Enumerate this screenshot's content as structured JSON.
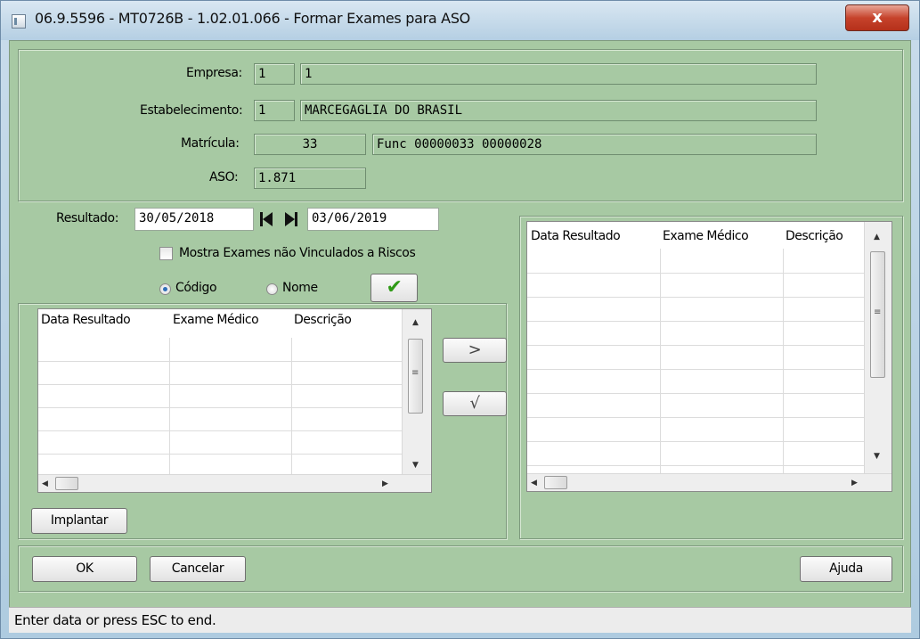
{
  "window": {
    "title": "06.9.5596 - MT0726B - 1.02.01.066 - Formar Exames para ASO",
    "close_label": "x"
  },
  "form": {
    "empresa_label": "Empresa:",
    "empresa_code": "1",
    "empresa_name": "1",
    "estabelecimento_label": "Estabelecimento:",
    "estabelecimento_code": "1",
    "estabelecimento_name": "MARCEGAGLIA DO BRASIL",
    "matricula_label": "Matrícula:",
    "matricula_value": "33",
    "matricula_name": "Func 00000033 00000028",
    "aso_label": "ASO:",
    "aso_value": "1.871"
  },
  "filter": {
    "resultado_label": "Resultado:",
    "date_from": "30/05/2018",
    "date_to": "03/06/2019",
    "checkbox_label": "Mostra Exames não Vinculados a Riscos",
    "radio_codigo": "Código",
    "radio_nome": "Nome",
    "confirm_glyph": "✔"
  },
  "left_grid": {
    "columns": [
      "Data Resultado",
      "Exame Médico",
      "Descrição"
    ]
  },
  "right_grid": {
    "columns": [
      "Data Resultado",
      "Exame Médico",
      "Descrição"
    ]
  },
  "transfer": {
    "add_glyph": ">",
    "confirm_glyph": "√"
  },
  "buttons": {
    "implantar": "Implantar",
    "ok": "OK",
    "cancelar": "Cancelar",
    "ajuda": "Ajuda"
  },
  "status": {
    "text": "Enter data or press ESC to end."
  },
  "colors": {
    "panel_bg": "#a7c9a3",
    "confirm_check": "#2f9a16"
  }
}
